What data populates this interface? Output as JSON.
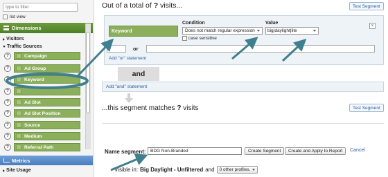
{
  "sidebar": {
    "filter_placeholder": "type to filter",
    "list_view_label": "list view",
    "dimensions_header": "Dimensions",
    "visitors_label": "Visitors",
    "traffic_sources_label": "Traffic Sources",
    "items": [
      {
        "label": "Campaign"
      },
      {
        "label": "Ad Group"
      },
      {
        "label": "Keyword"
      },
      {
        "label": ""
      },
      {
        "label": "Ad Slot"
      },
      {
        "label": "Ad Slot Position"
      },
      {
        "label": "Source"
      },
      {
        "label": "Medium"
      },
      {
        "label": "Referral Path"
      }
    ],
    "help_glyph": "?",
    "metrics_header": "Metrics",
    "site_usage_label": "Site Usage"
  },
  "main": {
    "title_prefix": "Out of a total of",
    "title_q": "?",
    "title_suffix": "visits...",
    "test_segment_label": "Test Segment",
    "dimension_chip": "Keyword",
    "condition_label": "Condition",
    "condition_value": "Does not match regular expression",
    "case_sensitive_label": "case sensitive",
    "value_label": "Value",
    "value_text": "big|daylight|lite",
    "close_glyph": "×",
    "or_label": "or",
    "add_or_label": "Add \"or\" statement",
    "and_label": "and",
    "add_and_label": "Add \"and\" statement",
    "match_prefix": "...this segment matches",
    "match_q": "?",
    "match_suffix": "visits",
    "name_segment_label": "Name segment:",
    "name_segment_value": "BDG Non-Branded",
    "create_segment_label": "Create Segment",
    "create_apply_label": "Create and Apply to Report",
    "cancel_label": "Cancel",
    "visible_in_label": "Visible in:",
    "profile_name": "Big Daylight - Unfiltered",
    "and_word": "and",
    "other_profiles_label": "0 other profiles."
  },
  "colors": {
    "dimension_green": "#8caf5c",
    "section_green": "#5a8a2e",
    "metrics_blue": "#4a7cbf",
    "annotation_teal": "#3f7f8e",
    "link_blue": "#2a5fa0"
  }
}
